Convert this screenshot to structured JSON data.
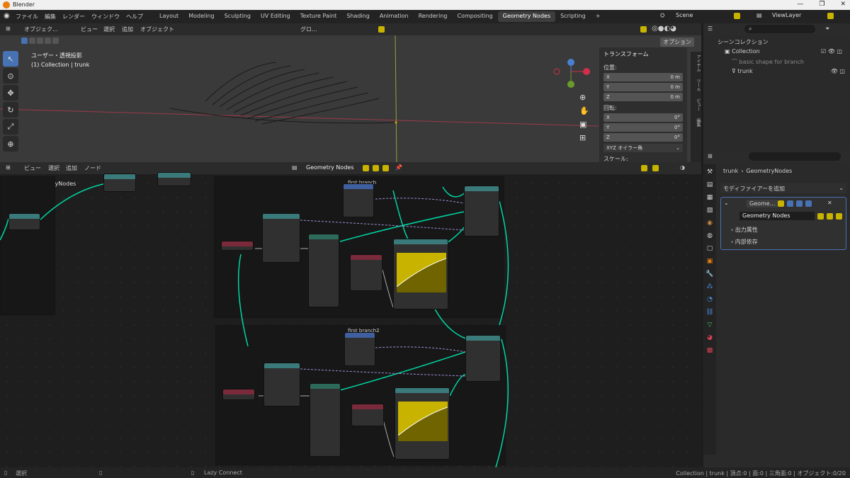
{
  "app": {
    "title": "Blender"
  },
  "menu": [
    "ファイル",
    "編集",
    "レンダー",
    "ウィンドウ",
    "ヘルプ"
  ],
  "workspaces": [
    "Layout",
    "Modeling",
    "Sculpting",
    "UV Editing",
    "Texture Paint",
    "Shading",
    "Animation",
    "Rendering",
    "Compositing",
    "Geometry Nodes",
    "Scripting",
    "+"
  ],
  "scene": {
    "name": "Scene",
    "view_layer": "ViewLayer"
  },
  "viewport": {
    "mode": "オブジェク...",
    "menus": [
      "ビュー",
      "選択",
      "追加",
      "オブジェクト"
    ],
    "transform_orient": "グロ...",
    "options": "オプション",
    "view_name": "ユーザー・透視投影",
    "collection_info": "(1) Collection | trunk"
  },
  "npanel": {
    "title": "トランスフォーム",
    "location_label": "位置:",
    "loc": [
      {
        "axis": "X",
        "value": "0 m"
      },
      {
        "axis": "Y",
        "value": "0 m"
      },
      {
        "axis": "Z",
        "value": "0 m"
      }
    ],
    "rotation_label": "回転:",
    "rot": [
      {
        "axis": "X",
        "value": "0°"
      },
      {
        "axis": "Y",
        "value": "0°"
      },
      {
        "axis": "Z",
        "value": "0°"
      }
    ],
    "rot_mode": "XYZ オイラー角",
    "scale_label": "スケール:",
    "tabs": [
      "アイテム",
      "ツール",
      "ビュー",
      "編集"
    ]
  },
  "node_editor": {
    "menus": [
      "ビュー",
      "選択",
      "追加",
      "ノード"
    ],
    "tree_name": "Geometry Nodes",
    "breadcrumb": [
      "trunk",
      "GeometryNodes"
    ],
    "frames": [
      "first branch",
      "first branch2"
    ]
  },
  "outliner": {
    "title": "シーンコレクション",
    "items": [
      "Collection",
      "basic shape for branch",
      "trunk"
    ]
  },
  "properties": {
    "breadcrumb": [
      "trunk",
      "GeometryNodes"
    ],
    "add_modifier": "モディファイアーを追加",
    "modifier_name": "Geome...",
    "nodegroup": "Geometry Nodes",
    "panels": [
      "出力属性",
      "内部依存"
    ]
  },
  "status": {
    "left": "選択",
    "mid": "Lazy Connect",
    "right": "Collection | trunk | 頂点:0 | 面:0 | 三角面:0 | オブジェクト:0/20"
  },
  "colors": {
    "accent": "#4772b3",
    "active_yellow": "#c8b400",
    "geometry_link": "#00d6a3"
  }
}
